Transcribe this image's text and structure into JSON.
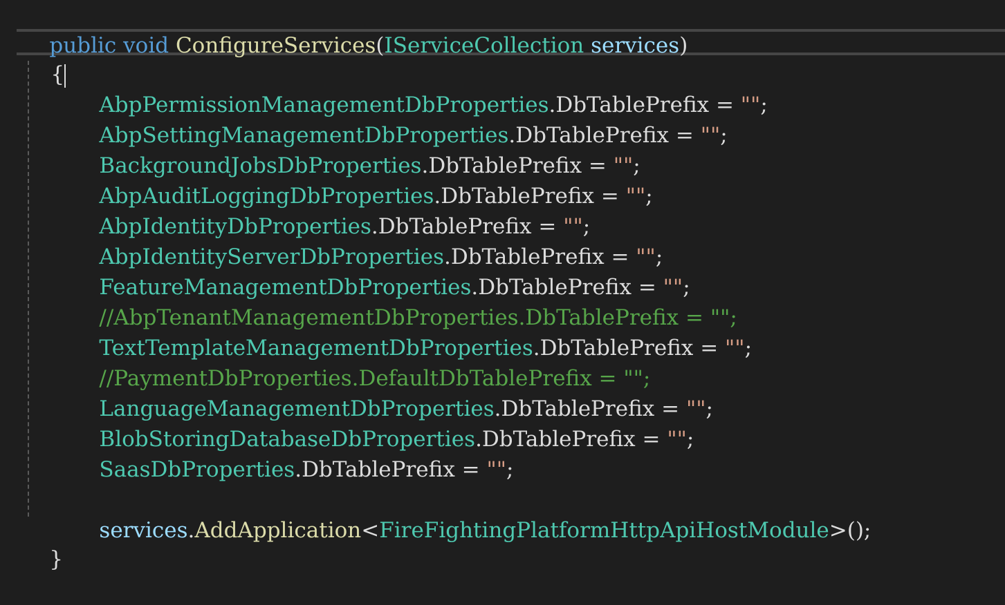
{
  "editor": {
    "colors": {
      "background": "#1e1e1e",
      "keyword": "#569cd6",
      "type": "#4ec9b0",
      "method": "#dcdcaa",
      "parameter": "#9cdcfe",
      "string": "#d69d85",
      "comment": "#57a64a",
      "text": "#dcdcdc"
    },
    "signature": {
      "kw_public": "public",
      "kw_void": "void",
      "method": "ConfigureServices",
      "open": "(",
      "param_type": "IServiceCollection",
      "param_name": "services",
      "close": ")"
    },
    "open_brace": "{",
    "close_brace": "}",
    "assign_lines": [
      {
        "type": "AbpPermissionManagementDbProperties",
        "dot": ".",
        "member": "DbTablePrefix",
        "eq": " = ",
        "str": "\"\"",
        "semi": ";"
      },
      {
        "type": "AbpSettingManagementDbProperties",
        "dot": ".",
        "member": "DbTablePrefix",
        "eq": " = ",
        "str": "\"\"",
        "semi": ";"
      },
      {
        "type": "BackgroundJobsDbProperties",
        "dot": ".",
        "member": "DbTablePrefix",
        "eq": " = ",
        "str": "\"\"",
        "semi": ";"
      },
      {
        "type": "AbpAuditLoggingDbProperties",
        "dot": ".",
        "member": "DbTablePrefix",
        "eq": " = ",
        "str": "\"\"",
        "semi": ";"
      },
      {
        "type": "AbpIdentityDbProperties",
        "dot": ".",
        "member": "DbTablePrefix",
        "eq": " = ",
        "str": "\"\"",
        "semi": ";"
      },
      {
        "type": "AbpIdentityServerDbProperties",
        "dot": ".",
        "member": "DbTablePrefix",
        "eq": " = ",
        "str": "\"\"",
        "semi": ";"
      },
      {
        "type": "FeatureManagementDbProperties",
        "dot": ".",
        "member": "DbTablePrefix",
        "eq": " = ",
        "str": "\"\"",
        "semi": ";"
      },
      {
        "type": "TextTemplateManagementDbProperties",
        "dot": ".",
        "member": "DbTablePrefix",
        "eq": " = ",
        "str": "\"\"",
        "semi": ";"
      },
      {
        "type": "LanguageManagementDbProperties",
        "dot": ".",
        "member": "DbTablePrefix",
        "eq": " = ",
        "str": "\"\"",
        "semi": ";"
      },
      {
        "type": "BlobStoringDatabaseDbProperties",
        "dot": ".",
        "member": "DbTablePrefix",
        "eq": " = ",
        "str": "\"\"",
        "semi": ";"
      },
      {
        "type": "SaasDbProperties",
        "dot": ".",
        "member": "DbTablePrefix",
        "eq": " = ",
        "str": "\"\"",
        "semi": ";"
      }
    ],
    "comment_lines": [
      "//AbpTenantManagementDbProperties.DbTablePrefix = \"\";",
      "//PaymentDbProperties.DefaultDbTablePrefix = \"\";"
    ],
    "add_app": {
      "obj": "services",
      "dot": ".",
      "method": "AddApplication",
      "lt": "<",
      "generic": "FireFightingPlatformHttpApiHostModule",
      "tail": ">();"
    }
  }
}
